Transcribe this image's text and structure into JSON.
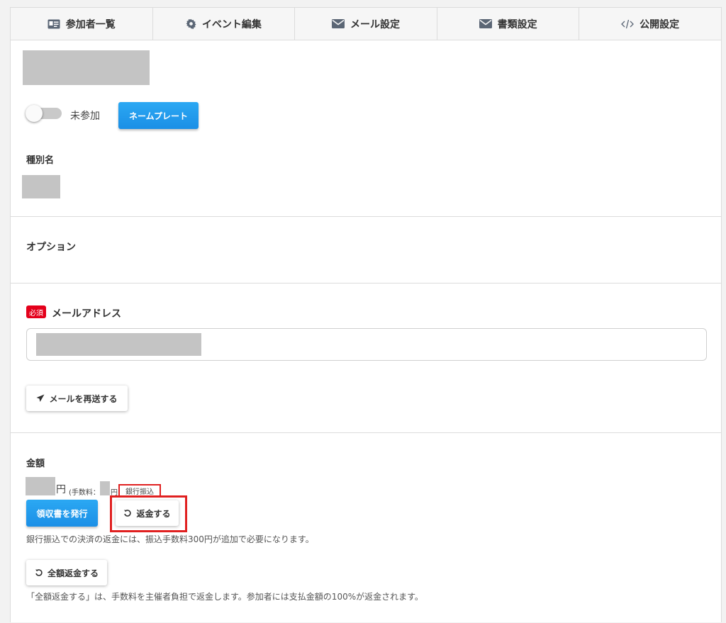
{
  "tabs": [
    {
      "label": "参加者一覧",
      "icon": "id-card-icon"
    },
    {
      "label": "イベント編集",
      "icon": "gear-icon"
    },
    {
      "label": "メール設定",
      "icon": "envelope-icon"
    },
    {
      "label": "書類設定",
      "icon": "envelope-icon"
    },
    {
      "label": "公開設定",
      "icon": "code-icon"
    }
  ],
  "attendance": {
    "status_label": "未参加",
    "nameplate_button": "ネームプレート"
  },
  "category": {
    "heading": "種別名"
  },
  "options": {
    "heading": "オプション"
  },
  "email": {
    "required_badge": "必須",
    "heading": "メールアドレス",
    "resend_button": "メールを再送する"
  },
  "amount": {
    "heading": "金額",
    "yen_label": "円",
    "fee_prefix": "(手数料：",
    "fee_yen": "円",
    "payment_method": "銀行振込",
    "receipt_button": "領収書を発行",
    "refund_button": "返金する",
    "bank_note": "銀行振込での決済の返金には、振込手数料300円が追加で必要になります。",
    "full_refund_button": "全額返金する",
    "full_refund_note": "「全額返金する」は、手数料を主催者負担で返金します。参加者には支払金額の100%が返金されます。"
  }
}
